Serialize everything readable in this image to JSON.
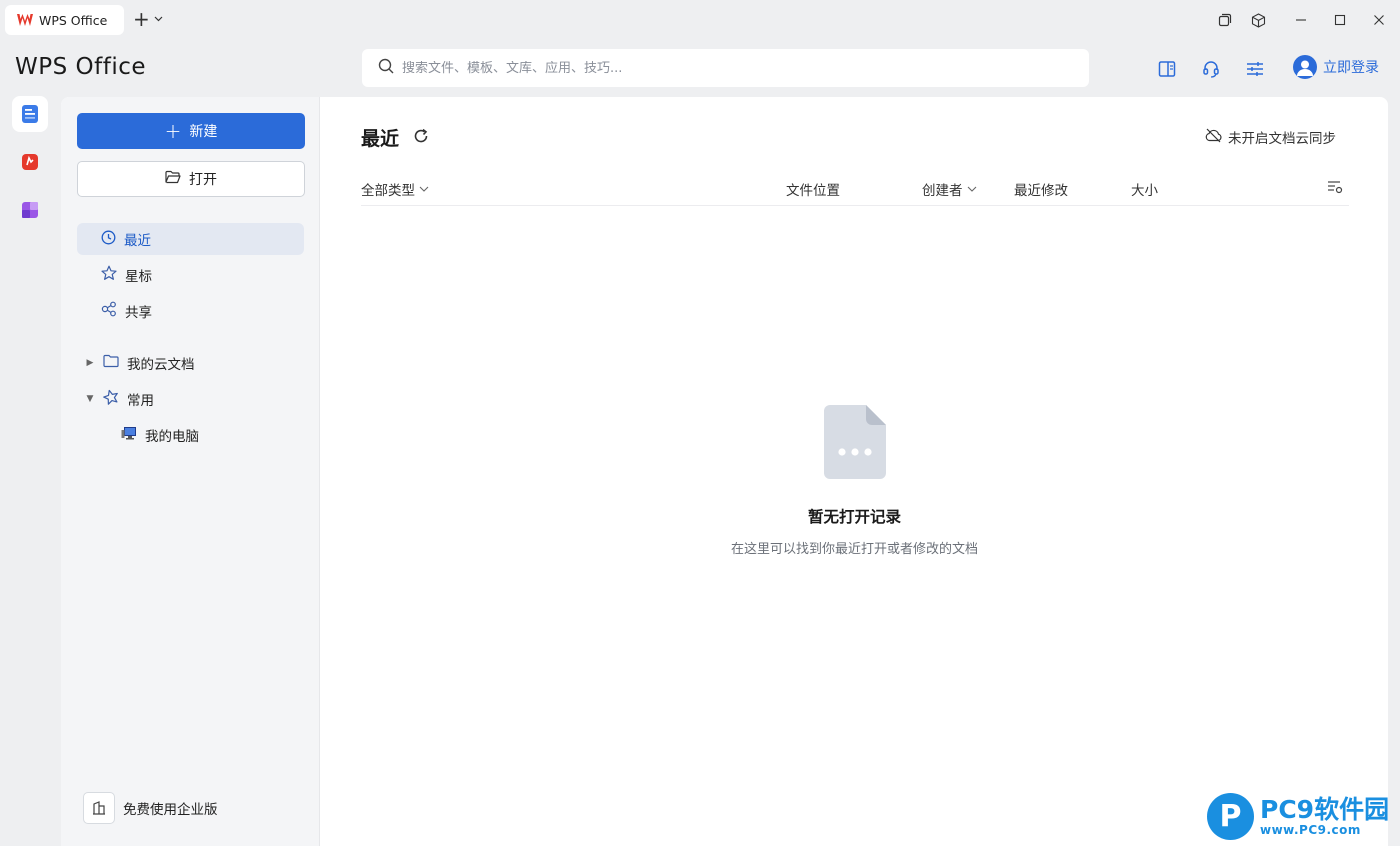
{
  "titlebar": {
    "tab_label": "WPS Office"
  },
  "header": {
    "brand": "WPS Office",
    "search_placeholder": "搜索文件、模板、文库、应用、技巧...",
    "login_label": "立即登录"
  },
  "sidebar": {
    "new_label": "新建",
    "open_label": "打开",
    "nav": [
      {
        "label": "最近",
        "icon": "clock-icon",
        "active": true
      },
      {
        "label": "星标",
        "icon": "star-icon",
        "active": false
      },
      {
        "label": "共享",
        "icon": "share-icon",
        "active": false
      }
    ],
    "tree": [
      {
        "label": "我的云文档",
        "icon": "folder-icon",
        "expanded": false
      },
      {
        "label": "常用",
        "icon": "pin-icon",
        "expanded": true
      },
      {
        "label": "我的电脑",
        "icon": "computer-icon"
      }
    ],
    "enterprise_label": "免费使用企业版"
  },
  "content": {
    "title": "最近",
    "cloud_sync_label": "未开启文档云同步",
    "columns": {
      "type": "全部类型",
      "location": "文件位置",
      "creator": "创建者",
      "modified": "最近修改",
      "size": "大小"
    },
    "empty_title": "暂无打开记录",
    "empty_subtitle": "在这里可以找到你最近打开或者修改的文档"
  },
  "watermark": {
    "text": "PC9软件园",
    "url": "www.PC9.com"
  },
  "colors": {
    "accent": "#2b6bd9",
    "brand_red": "#e5392c"
  }
}
